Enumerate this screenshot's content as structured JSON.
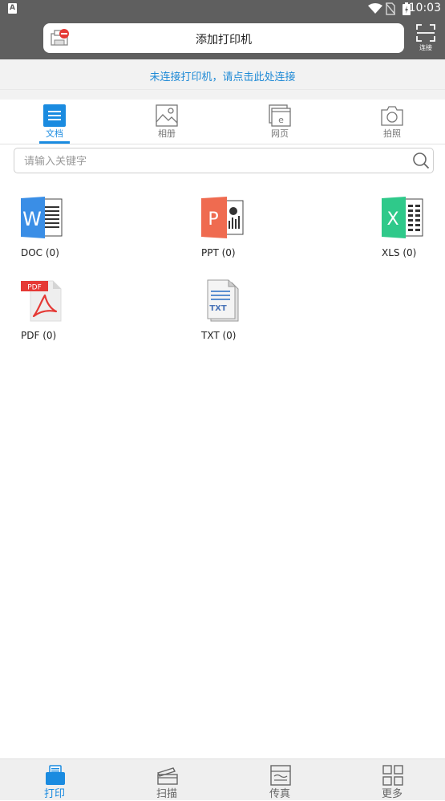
{
  "status_bar": {
    "time": "10:03",
    "badge": "A"
  },
  "header": {
    "add_printer_label": "添加打印机",
    "scan_label": "连接"
  },
  "banner": {
    "text": "未连接打印机，请点击此处连接"
  },
  "tabs": [
    {
      "label": "文档",
      "icon": "document-icon",
      "active": true
    },
    {
      "label": "相册",
      "icon": "photo-icon",
      "active": false
    },
    {
      "label": "网页",
      "icon": "webpage-icon",
      "active": false
    },
    {
      "label": "拍照",
      "icon": "camera-icon",
      "active": false
    }
  ],
  "search": {
    "placeholder": "请输入关键字"
  },
  "files": [
    {
      "label": "DOC (0)",
      "icon": "word-doc-icon"
    },
    {
      "label": "PPT (0)",
      "icon": "powerpoint-icon"
    },
    {
      "label": "XLS (0)",
      "icon": "excel-icon"
    },
    {
      "label": "PDF (0)",
      "icon": "pdf-icon"
    },
    {
      "label": "TXT (0)",
      "icon": "txt-icon"
    }
  ],
  "file_icon_text": {
    "word": "W",
    "ppt": "P",
    "xls": "X",
    "pdf": "PDF",
    "txt": "TXT"
  },
  "bottom_nav": [
    {
      "label": "打印",
      "icon": "print-icon",
      "active": true
    },
    {
      "label": "扫描",
      "icon": "scan-icon",
      "active": false
    },
    {
      "label": "传真",
      "icon": "fax-icon",
      "active": false
    },
    {
      "label": "更多",
      "icon": "more-grid-icon",
      "active": false
    }
  ],
  "colors": {
    "accent": "#1a8be0",
    "header": "#5f5f5f",
    "word": "#3a8ee6",
    "ppt": "#ef6b50",
    "xls": "#2fc98a",
    "pdf": "#e53935"
  }
}
